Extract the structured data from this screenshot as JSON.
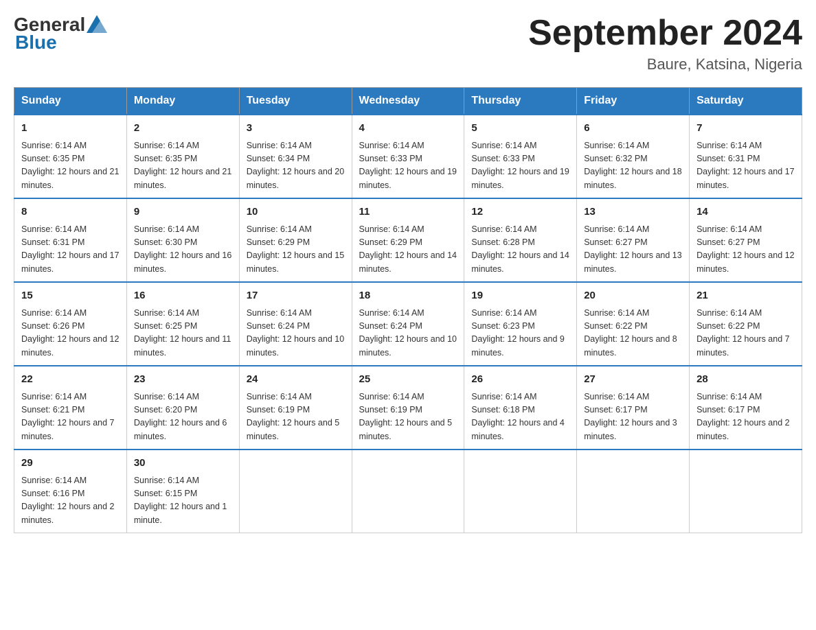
{
  "header": {
    "logo_general": "General",
    "logo_blue": "Blue",
    "main_title": "September 2024",
    "subtitle": "Baure, Katsina, Nigeria"
  },
  "days_of_week": [
    "Sunday",
    "Monday",
    "Tuesday",
    "Wednesday",
    "Thursday",
    "Friday",
    "Saturday"
  ],
  "weeks": [
    [
      {
        "day": "1",
        "sunrise": "Sunrise: 6:14 AM",
        "sunset": "Sunset: 6:35 PM",
        "daylight": "Daylight: 12 hours and 21 minutes."
      },
      {
        "day": "2",
        "sunrise": "Sunrise: 6:14 AM",
        "sunset": "Sunset: 6:35 PM",
        "daylight": "Daylight: 12 hours and 21 minutes."
      },
      {
        "day": "3",
        "sunrise": "Sunrise: 6:14 AM",
        "sunset": "Sunset: 6:34 PM",
        "daylight": "Daylight: 12 hours and 20 minutes."
      },
      {
        "day": "4",
        "sunrise": "Sunrise: 6:14 AM",
        "sunset": "Sunset: 6:33 PM",
        "daylight": "Daylight: 12 hours and 19 minutes."
      },
      {
        "day": "5",
        "sunrise": "Sunrise: 6:14 AM",
        "sunset": "Sunset: 6:33 PM",
        "daylight": "Daylight: 12 hours and 19 minutes."
      },
      {
        "day": "6",
        "sunrise": "Sunrise: 6:14 AM",
        "sunset": "Sunset: 6:32 PM",
        "daylight": "Daylight: 12 hours and 18 minutes."
      },
      {
        "day": "7",
        "sunrise": "Sunrise: 6:14 AM",
        "sunset": "Sunset: 6:31 PM",
        "daylight": "Daylight: 12 hours and 17 minutes."
      }
    ],
    [
      {
        "day": "8",
        "sunrise": "Sunrise: 6:14 AM",
        "sunset": "Sunset: 6:31 PM",
        "daylight": "Daylight: 12 hours and 17 minutes."
      },
      {
        "day": "9",
        "sunrise": "Sunrise: 6:14 AM",
        "sunset": "Sunset: 6:30 PM",
        "daylight": "Daylight: 12 hours and 16 minutes."
      },
      {
        "day": "10",
        "sunrise": "Sunrise: 6:14 AM",
        "sunset": "Sunset: 6:29 PM",
        "daylight": "Daylight: 12 hours and 15 minutes."
      },
      {
        "day": "11",
        "sunrise": "Sunrise: 6:14 AM",
        "sunset": "Sunset: 6:29 PM",
        "daylight": "Daylight: 12 hours and 14 minutes."
      },
      {
        "day": "12",
        "sunrise": "Sunrise: 6:14 AM",
        "sunset": "Sunset: 6:28 PM",
        "daylight": "Daylight: 12 hours and 14 minutes."
      },
      {
        "day": "13",
        "sunrise": "Sunrise: 6:14 AM",
        "sunset": "Sunset: 6:27 PM",
        "daylight": "Daylight: 12 hours and 13 minutes."
      },
      {
        "day": "14",
        "sunrise": "Sunrise: 6:14 AM",
        "sunset": "Sunset: 6:27 PM",
        "daylight": "Daylight: 12 hours and 12 minutes."
      }
    ],
    [
      {
        "day": "15",
        "sunrise": "Sunrise: 6:14 AM",
        "sunset": "Sunset: 6:26 PM",
        "daylight": "Daylight: 12 hours and 12 minutes."
      },
      {
        "day": "16",
        "sunrise": "Sunrise: 6:14 AM",
        "sunset": "Sunset: 6:25 PM",
        "daylight": "Daylight: 12 hours and 11 minutes."
      },
      {
        "day": "17",
        "sunrise": "Sunrise: 6:14 AM",
        "sunset": "Sunset: 6:24 PM",
        "daylight": "Daylight: 12 hours and 10 minutes."
      },
      {
        "day": "18",
        "sunrise": "Sunrise: 6:14 AM",
        "sunset": "Sunset: 6:24 PM",
        "daylight": "Daylight: 12 hours and 10 minutes."
      },
      {
        "day": "19",
        "sunrise": "Sunrise: 6:14 AM",
        "sunset": "Sunset: 6:23 PM",
        "daylight": "Daylight: 12 hours and 9 minutes."
      },
      {
        "day": "20",
        "sunrise": "Sunrise: 6:14 AM",
        "sunset": "Sunset: 6:22 PM",
        "daylight": "Daylight: 12 hours and 8 minutes."
      },
      {
        "day": "21",
        "sunrise": "Sunrise: 6:14 AM",
        "sunset": "Sunset: 6:22 PM",
        "daylight": "Daylight: 12 hours and 7 minutes."
      }
    ],
    [
      {
        "day": "22",
        "sunrise": "Sunrise: 6:14 AM",
        "sunset": "Sunset: 6:21 PM",
        "daylight": "Daylight: 12 hours and 7 minutes."
      },
      {
        "day": "23",
        "sunrise": "Sunrise: 6:14 AM",
        "sunset": "Sunset: 6:20 PM",
        "daylight": "Daylight: 12 hours and 6 minutes."
      },
      {
        "day": "24",
        "sunrise": "Sunrise: 6:14 AM",
        "sunset": "Sunset: 6:19 PM",
        "daylight": "Daylight: 12 hours and 5 minutes."
      },
      {
        "day": "25",
        "sunrise": "Sunrise: 6:14 AM",
        "sunset": "Sunset: 6:19 PM",
        "daylight": "Daylight: 12 hours and 5 minutes."
      },
      {
        "day": "26",
        "sunrise": "Sunrise: 6:14 AM",
        "sunset": "Sunset: 6:18 PM",
        "daylight": "Daylight: 12 hours and 4 minutes."
      },
      {
        "day": "27",
        "sunrise": "Sunrise: 6:14 AM",
        "sunset": "Sunset: 6:17 PM",
        "daylight": "Daylight: 12 hours and 3 minutes."
      },
      {
        "day": "28",
        "sunrise": "Sunrise: 6:14 AM",
        "sunset": "Sunset: 6:17 PM",
        "daylight": "Daylight: 12 hours and 2 minutes."
      }
    ],
    [
      {
        "day": "29",
        "sunrise": "Sunrise: 6:14 AM",
        "sunset": "Sunset: 6:16 PM",
        "daylight": "Daylight: 12 hours and 2 minutes."
      },
      {
        "day": "30",
        "sunrise": "Sunrise: 6:14 AM",
        "sunset": "Sunset: 6:15 PM",
        "daylight": "Daylight: 12 hours and 1 minute."
      },
      null,
      null,
      null,
      null,
      null
    ]
  ]
}
